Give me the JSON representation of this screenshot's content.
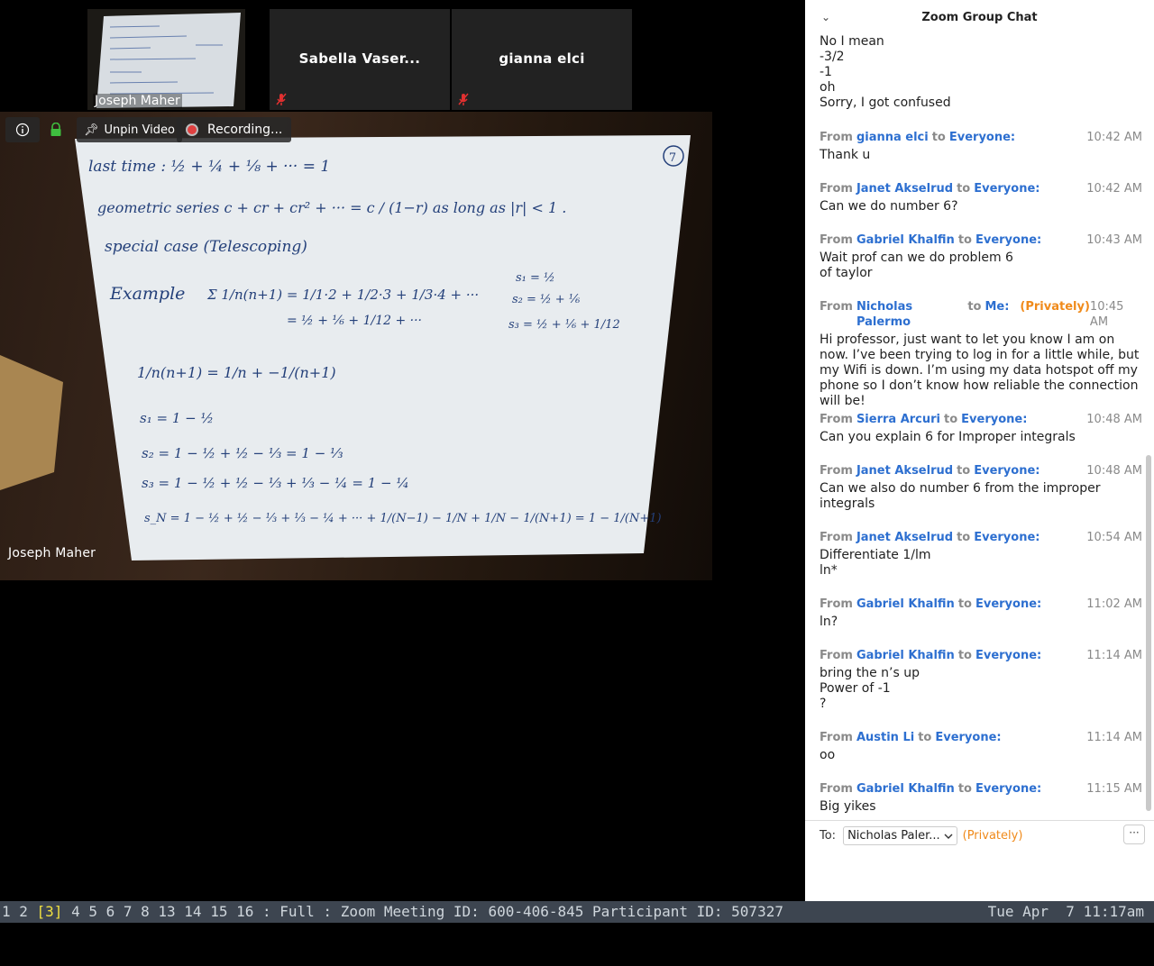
{
  "video": {
    "thumbnails": [
      {
        "name": "Joseph Maher"
      },
      {
        "name": "Sabella Vaser..."
      },
      {
        "name": "gianna elci"
      }
    ],
    "toolbar": {
      "unpin_label": "Unpin Video",
      "recording_label": "Recording..."
    },
    "main_speaker": "Joseph Maher",
    "whiteboard": {
      "page_number": "7",
      "line1": "last time :  ½ + ¼ + ⅛ + ···  =  1",
      "line2": "geometric series   c + cr + cr² + ···   =   c / (1−r)   as long as |r| < 1 .",
      "line3": "special case  (Telescoping)",
      "example": "Example",
      "sum1": "Σ 1/n(n+1)  =  1/1·2 + 1/2·3 + 1/3·4 + ···",
      "sum2": "= ½ + ⅙ + 1/12 + ···",
      "s1r": "s₁ = ½",
      "s2r": "s₂ = ½ + ⅙",
      "s3r": "s₃ = ½ + ⅙ + 1/12",
      "frac": "1/n(n+1)  =  1/n  +  −1/(n+1)",
      "ps1": "s₁ = 1 − ½",
      "ps2": "s₂ = 1 − ½ + ½ − ⅓ = 1 − ⅓",
      "ps3": "s₃ = 1 − ½ + ½ − ⅓ + ⅓ − ¼ = 1 − ¼",
      "psn": "s_N = 1 − ½ + ½ − ⅓ + ⅓ − ¼ + ··· + 1/(N−1) − 1/N + 1/N − 1/(N+1)  =  1 − 1/(N+1)"
    }
  },
  "chat": {
    "title": "Zoom Group Chat",
    "messages": [
      {
        "from": "",
        "to": "",
        "private": "",
        "time": "",
        "lines": [
          "No I mean",
          "-3/2",
          "-1",
          "oh",
          "Sorry, I got confused"
        ]
      },
      {
        "from": "gianna elci",
        "to": "Everyone:",
        "private": "",
        "time": "10:42 AM",
        "lines": [
          "Thank u"
        ]
      },
      {
        "from": "Janet Akselrud",
        "to": "Everyone:",
        "private": "",
        "time": "10:42 AM",
        "lines": [
          "Can we do number 6?"
        ]
      },
      {
        "from": "Gabriel Khalfin",
        "to": "Everyone:",
        "private": "",
        "time": "10:43 AM",
        "lines": [
          "Wait prof can we do problem 6",
          "of taylor"
        ]
      },
      {
        "from": "Nicholas Palermo",
        "to": "Me:",
        "private": "(Privately)",
        "time": "10:45 AM",
        "lines": [
          "Hi professor, just want to let you know I am on now. I’ve been trying to log in for a little while, but my Wifi is down. I’m using my data hotspot off my phone so I don’t know how reliable the connection will be!"
        ]
      },
      {
        "from": "Sierra Arcuri",
        "to": "Everyone:",
        "private": "",
        "time": "10:48 AM",
        "lines": [
          "Can you explain 6 for Improper integrals"
        ]
      },
      {
        "from": "Janet Akselrud",
        "to": "Everyone:",
        "private": "",
        "time": "10:48 AM",
        "lines": [
          "Can we also do number 6 from the improper integrals"
        ]
      },
      {
        "from": "Janet Akselrud",
        "to": "Everyone:",
        "private": "",
        "time": "10:54 AM",
        "lines": [
          "Differentiate 1/lm",
          "ln*"
        ]
      },
      {
        "from": "Gabriel Khalfin",
        "to": "Everyone:",
        "private": "",
        "time": "11:02 AM",
        "lines": [
          "ln?"
        ]
      },
      {
        "from": "Gabriel Khalfin",
        "to": "Everyone:",
        "private": "",
        "time": "11:14 AM",
        "lines": [
          "bring the n’s up",
          "Power of -1",
          "?"
        ]
      },
      {
        "from": "Austin Li",
        "to": "Everyone:",
        "private": "",
        "time": "11:14 AM",
        "lines": [
          "oo"
        ]
      },
      {
        "from": "Gabriel Khalfin",
        "to": "Everyone:",
        "private": "",
        "time": "11:15 AM",
        "lines": [
          "Big yikes"
        ]
      }
    ],
    "from_prefix": "From",
    "to_word": "to",
    "to_label": "To:",
    "recipient": "Nicholas Paler...",
    "privately": "(Privately)",
    "more": "···"
  },
  "statusbar": {
    "workspaces_before": "1 2 ",
    "current": "[3]",
    "workspaces_after": " 4 5 6 7 8 13 14 15 16 : Full : Zoom Meeting ID: 600-406-845 Participant ID: 507327",
    "clock": "Tue Apr  7 11:17am"
  },
  "colors": {
    "accent_blue": "#2d6fd0",
    "private_orange": "#f08a1a",
    "statusbar_bg": "#3d4550"
  }
}
